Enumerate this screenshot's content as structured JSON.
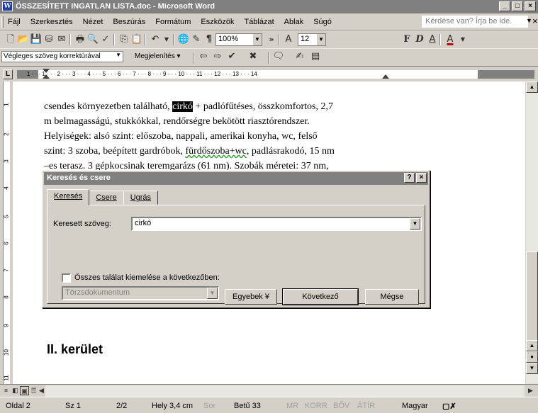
{
  "window": {
    "title": "ÖSSZESÍTETT INGATLAN LISTA.doc - Microsoft Word",
    "app_icon": "W",
    "minimize": "_",
    "restore": "□",
    "close": "×"
  },
  "menubar": {
    "items": [
      "Fájl",
      "Szerkesztés",
      "Nézet",
      "Beszúrás",
      "Formátum",
      "Eszközök",
      "Táblázat",
      "Ablak",
      "Súgó"
    ],
    "help_placeholder": "Kérdése van? Írja be ide.",
    "close_doc": "×"
  },
  "toolbar_standard": {
    "zoom": "100%",
    "font_size": "12"
  },
  "toolbar_reviewing": {
    "display_mode": "Végleges szöveg korrektúrával",
    "show_menu": "Megjelenítés"
  },
  "ruler": {
    "tab_selector": "L",
    "numbers": "1 · · · 1 · · · 2 · · · 3 · · · 4 · · · 5 · · · 6 · · · 7 · · · 8 · · · 9 · · · 10 · · · 11 · · · 12 · · · 13 · · · 14"
  },
  "document": {
    "lines": [
      {
        "before": "csendes környezetben található, ",
        "highlight": "cirkó",
        "after": " + padlófűtéses, összkomfortos, 2,7"
      },
      {
        "text": "m belmagasságú, stukkókkal, rendőrségre bekötött riasztórendszer."
      },
      {
        "text": "Helyiségek: alsó szint: előszoba, nappali, amerikai konyha, wc, felső"
      },
      {
        "before": "szint: 3 szoba, beépített gardróbok, ",
        "squiggle": "fürdőszoba+wc",
        "after": ", padlásrakodó, 15 nm"
      },
      {
        "squiggle_start": "–es",
        "after": " terasz. 3 gépkocsinak teremgarázs (61 nm). Szobák méretei: 37 nm,"
      }
    ],
    "heading": "II. kerület"
  },
  "dialog": {
    "title": "Keresés és csere",
    "help_btn": "?",
    "close_btn": "×",
    "tabs": [
      {
        "label": "Keresés",
        "active": true
      },
      {
        "label": "Csere",
        "active": false
      },
      {
        "label": "Ugrás",
        "active": false
      }
    ],
    "search_label": "Keresett szöveg:",
    "search_value": "cirkó",
    "highlight_all_label": "Összes találat kiemelése a következőben:",
    "scope_value": "Törzsdokumentum",
    "more_button": "Egyebek ¥",
    "next_button": "Következő",
    "cancel_button": "Mégse"
  },
  "statusbar": {
    "page": "Oldal 2",
    "section": "Sz 1",
    "page_of": "2/2",
    "position": "Hely 3,4 cm",
    "line": "Sor",
    "column": "Betű 33",
    "mr": "MR",
    "korr": "KORR",
    "bov": "BŐV",
    "atir": "ÁTÍR",
    "language": "Magyar"
  }
}
